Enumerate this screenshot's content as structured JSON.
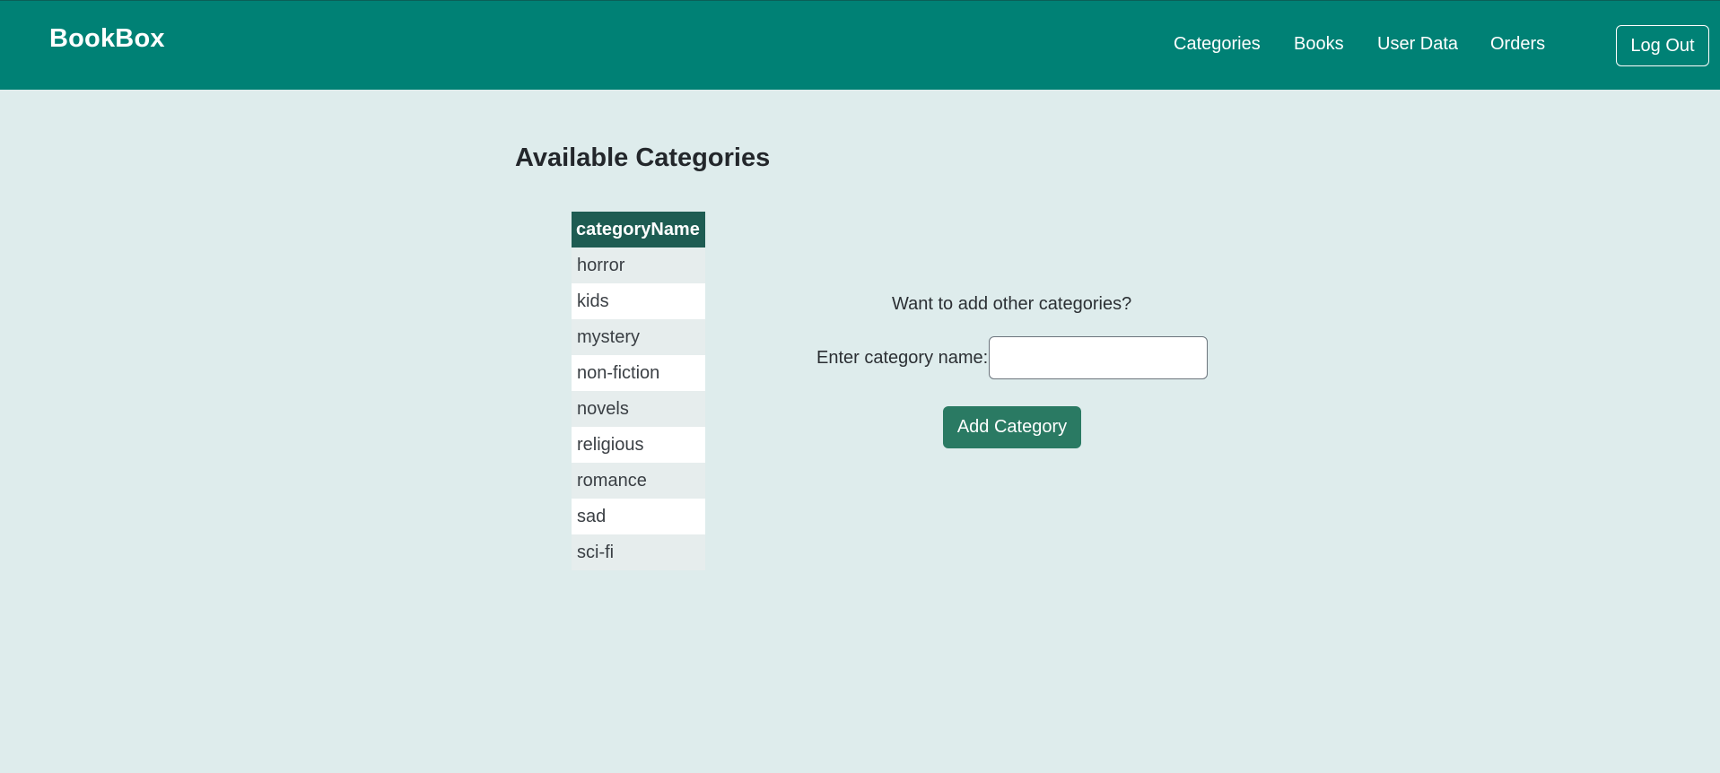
{
  "nav": {
    "brand": "BookBox",
    "links": [
      {
        "label": "Categories"
      },
      {
        "label": "Books"
      },
      {
        "label": "User Data"
      },
      {
        "label": "Orders"
      }
    ],
    "logout_label": "Log Out"
  },
  "main": {
    "title": "Available Categories",
    "table": {
      "header": "categoryName",
      "rows": [
        "horror",
        "kids",
        "mystery",
        "non-fiction",
        "novels",
        "religious",
        "romance",
        "sad",
        "sci-fi"
      ]
    },
    "form": {
      "prompt": "Want to add other categories?",
      "field_label": "Enter category name:",
      "input_value": "",
      "button_label": "Add Category"
    }
  },
  "colors": {
    "navbar": "#008175",
    "background": "#deecec",
    "table_header": "#1e5c52",
    "button": "#2a7a63"
  }
}
